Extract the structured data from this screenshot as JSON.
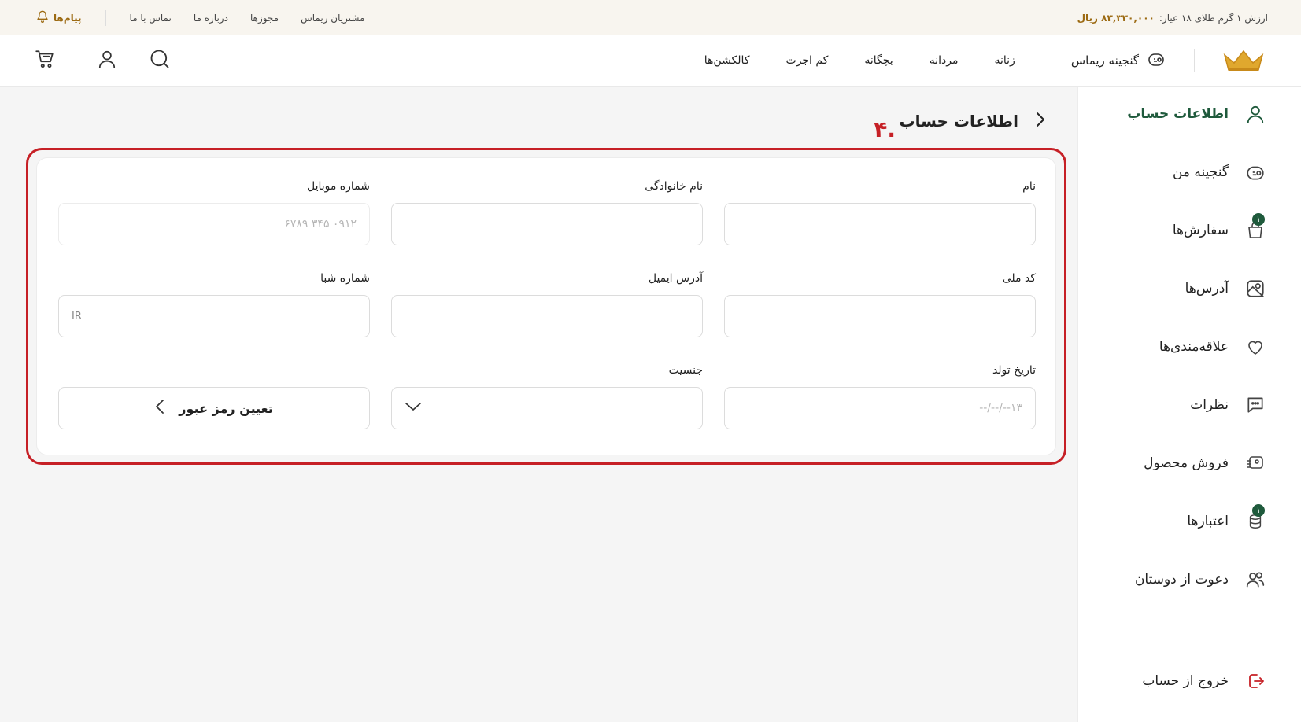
{
  "topbar": {
    "gold_price_label": "ارزش ۱ گرم طلای ۱۸ عیار:",
    "gold_price_value": "۸۳,۳۳۰,۰۰۰ ریال",
    "links": [
      "مشتریان ریماس",
      "مجوزها",
      "درباره ما",
      "تماس با ما"
    ],
    "messages_label": "پیام‌ها"
  },
  "header": {
    "treasury_label": "گنجینه ریماس",
    "nav": [
      "زنانه",
      "مردانه",
      "بچگانه",
      "کم اجرت",
      "کالکشن‌ها"
    ]
  },
  "sidebar": {
    "items": [
      {
        "label": "اطلاعات حساب",
        "icon": "user-icon",
        "active": true
      },
      {
        "label": "گنجینه من",
        "icon": "treasury-icon"
      },
      {
        "label": "سفارش‌ها",
        "icon": "bag-icon",
        "badge": "۱"
      },
      {
        "label": "آدرس‌ها",
        "icon": "map-icon"
      },
      {
        "label": "علاقه‌مندی‌ها",
        "icon": "heart-icon"
      },
      {
        "label": "نظرات",
        "icon": "comment-icon"
      },
      {
        "label": "فروش محصول",
        "icon": "sell-icon"
      },
      {
        "label": "اعتبارها",
        "icon": "coins-icon",
        "badge": "۱"
      },
      {
        "label": "دعوت از دوستان",
        "icon": "users-icon"
      }
    ],
    "logout_label": "خروج از حساب"
  },
  "main": {
    "title": "اطلاعات حساب",
    "step_number": ".۴",
    "form": {
      "first_name": {
        "label": "نام",
        "value": ""
      },
      "last_name": {
        "label": "نام خانوادگی",
        "value": ""
      },
      "mobile": {
        "label": "شماره موبایل",
        "value": "۰۹۱۲ ۳۴۵ ۶۷۸۹"
      },
      "national_code": {
        "label": "کد ملی",
        "value": ""
      },
      "email": {
        "label": "آدرس ایمیل",
        "value": ""
      },
      "sheba": {
        "label": "شماره شبا",
        "prefix": "IR"
      },
      "birth_date": {
        "label": "تاریخ تولد",
        "placeholder": "۱۳--/--/--"
      },
      "gender": {
        "label": "جنسیت",
        "value": ""
      },
      "set_password_label": "تعیین رمز عبور"
    }
  },
  "colors": {
    "accent_green": "#1f5a3c",
    "gold": "#9c6a12",
    "highlight_red": "#c62026",
    "topbar_bg": "#f8f5ef"
  }
}
